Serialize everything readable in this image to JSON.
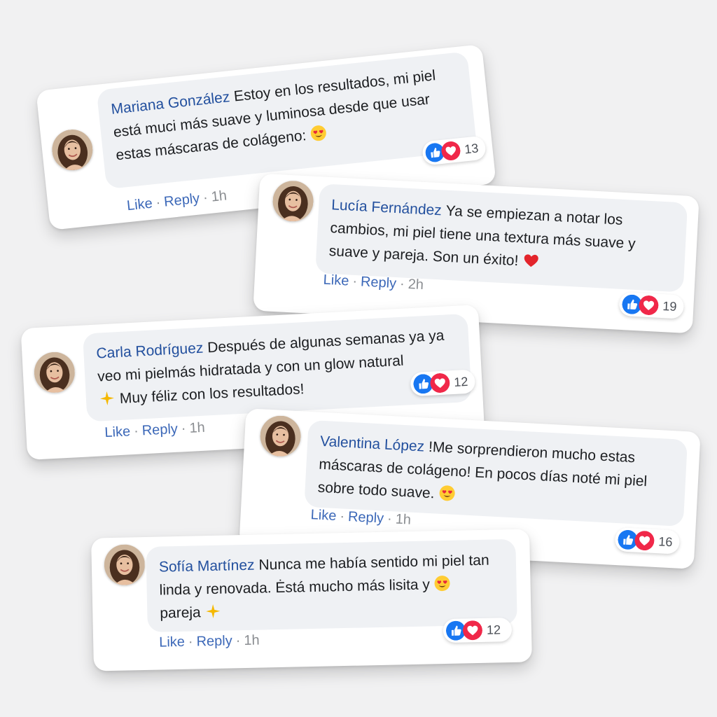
{
  "comments": [
    {
      "name": "Mariana González",
      "text": "Estoy en los resultados, mi piel está muci más suave y luminosa desde que usar e͏stas máscaras de colágeno:",
      "emoji": "heart-eyes-emoji",
      "like": "Like",
      "reply": "Reply",
      "time": "1h",
      "reaction_count": "13"
    },
    {
      "name": "Lucía Fernández",
      "text": "Ya se empiezan a notar los cambios, mi piel tiene una textura más suave y suave y pareja. Son un éxito!",
      "emoji": "red-heart-emoji",
      "like": "Like",
      "reply": "Reply",
      "time": "2h",
      "reaction_count": "19"
    },
    {
      "name": "Carla Rodríguez",
      "text": "Después de algunas semanas ya ya veo mi pielmás hidratada y con un glow natural",
      "text2": "Muy féliz con los resultados!",
      "emoji": "sparkle-emoji",
      "like": "Like",
      "reply": "Reply",
      "time": "1h",
      "reaction_count": "12"
    },
    {
      "name": "Valentina López",
      "text": "!Me sorprendieron mucho estas máscaras de colágeno! En pocos días noté mi piel sobre todo suave.",
      "emoji": "heart-eyes-emoji",
      "like": "Like",
      "reply": "Reply",
      "time": "1h",
      "reaction_count": "16"
    },
    {
      "name": "Sofía Martínez",
      "text": "Nunca me había sentido mi piel tan linda y renovada. Ėstá mucho más lisita y",
      "text2": "pareja",
      "emoji": "heart-eyes-emoji",
      "emoji2": "sparkle-emoji",
      "like": "Like",
      "reply": "Reply",
      "time": "1h",
      "reaction_count": "12"
    }
  ],
  "colors": {
    "name": "#23509e",
    "link": "#3c68b8",
    "like_blue": "#1877f2",
    "love_red": "#f02849",
    "bubble": "#eff1f4"
  }
}
